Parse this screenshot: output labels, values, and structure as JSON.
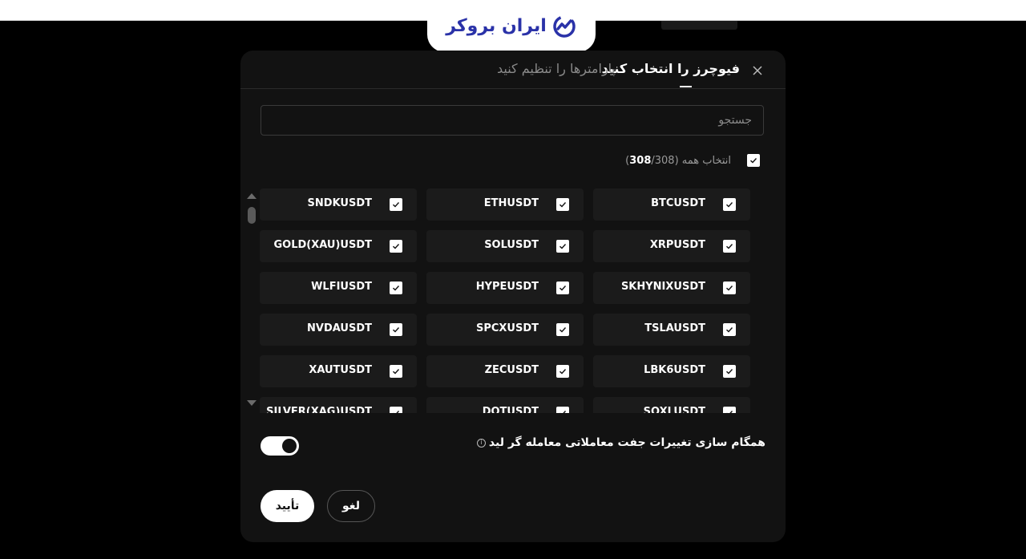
{
  "brand": {
    "name": "ایران بروکر",
    "color": "#2a32a8"
  },
  "modal": {
    "tabs": [
      {
        "label": "فیوچرز را انتخاب کنید",
        "active": true
      },
      {
        "label": "پارامترها را تنظیم کنید",
        "active": false
      }
    ],
    "search": {
      "placeholder": "جستجو",
      "value": ""
    },
    "select_all": {
      "label": "انتخاب همه (",
      "selected": "308",
      "total": "/308)",
      "checked": true
    },
    "symbols": [
      {
        "name": "BTCUSDT",
        "checked": true
      },
      {
        "name": "ETHUSDT",
        "checked": true
      },
      {
        "name": "SNDKUSDT",
        "checked": true
      },
      {
        "name": "XRPUSDT",
        "checked": true
      },
      {
        "name": "SOLUSDT",
        "checked": true
      },
      {
        "name": "GOLD(XAU)USDT",
        "checked": true
      },
      {
        "name": "SKHYNIXUSDT",
        "checked": true
      },
      {
        "name": "HYPEUSDT",
        "checked": true
      },
      {
        "name": "WLFIUSDT",
        "checked": true
      },
      {
        "name": "TSLAUSDT",
        "checked": true
      },
      {
        "name": "SPCXUSDT",
        "checked": true
      },
      {
        "name": "NVDAUSDT",
        "checked": true
      },
      {
        "name": "LBK6USDT",
        "checked": true
      },
      {
        "name": "ZECUSDT",
        "checked": true
      },
      {
        "name": "XAUTUSDT",
        "checked": true
      },
      {
        "name": "SOXLUSDT",
        "checked": true
      },
      {
        "name": "DOTUSDT",
        "checked": true
      },
      {
        "name": "SILVER(XAG)USDT",
        "checked": true
      }
    ],
    "sync": {
      "label": "همگام سازی تغییرات جفت معاملاتی معامله گر لید",
      "enabled": true
    },
    "buttons": {
      "confirm": "تأیید",
      "cancel": "لغو"
    }
  }
}
